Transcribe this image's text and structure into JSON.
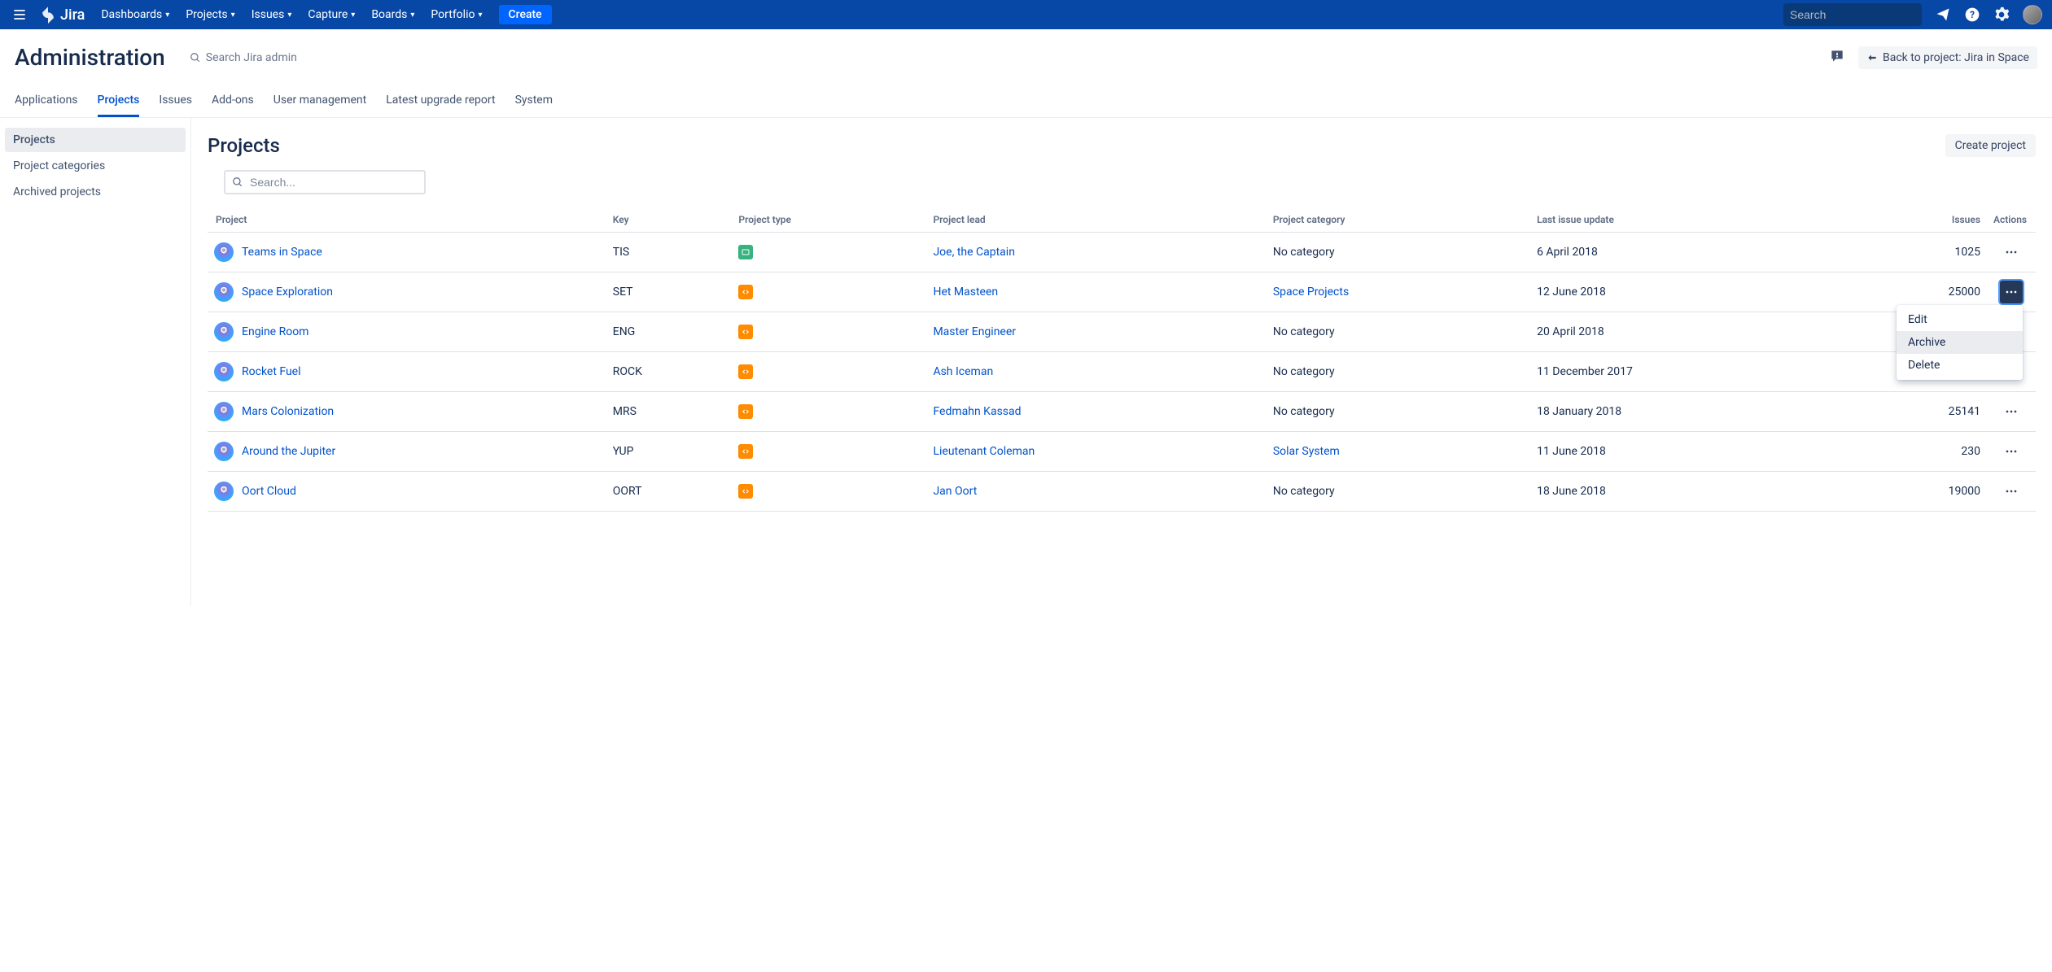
{
  "topnav": {
    "logo_text": "Jira",
    "items": [
      "Dashboards",
      "Projects",
      "Issues",
      "Capture",
      "Boards",
      "Portfolio"
    ],
    "create_label": "Create",
    "search_placeholder": "Search"
  },
  "admin": {
    "title": "Administration",
    "search_label": "Search Jira admin",
    "back_label": "Back to project: Jira in Space",
    "tabs": [
      "Applications",
      "Projects",
      "Issues",
      "Add-ons",
      "User management",
      "Latest upgrade report",
      "System"
    ],
    "active_tab_index": 1
  },
  "sidebar": {
    "items": [
      "Projects",
      "Project categories",
      "Archived projects"
    ],
    "active_index": 0
  },
  "main": {
    "title": "Projects",
    "create_project_label": "Create project",
    "filter_placeholder": "Search..."
  },
  "table": {
    "columns": [
      "Project",
      "Key",
      "Project type",
      "Project lead",
      "Project category",
      "Last issue update",
      "Issues",
      "Actions"
    ],
    "rows": [
      {
        "name": "Teams in Space",
        "key": "TIS",
        "type": "business",
        "lead": "Joe, the Captain",
        "category": "No category",
        "category_link": false,
        "updated": "6 April 2018",
        "issues": "1025"
      },
      {
        "name": "Space Exploration",
        "key": "SET",
        "type": "software",
        "lead": "Het Masteen",
        "category": "Space Projects",
        "category_link": true,
        "updated": "12 June 2018",
        "issues": "25000"
      },
      {
        "name": "Engine Room",
        "key": "ENG",
        "type": "software",
        "lead": "Master Engineer",
        "category": "No category",
        "category_link": false,
        "updated": "20 April 2018",
        "issues": ""
      },
      {
        "name": "Rocket Fuel",
        "key": "ROCK",
        "type": "software",
        "lead": "Ash Iceman",
        "category": "No category",
        "category_link": false,
        "updated": "11 December 2017",
        "issues": ""
      },
      {
        "name": "Mars Colonization",
        "key": "MRS",
        "type": "software",
        "lead": "Fedmahn Kassad",
        "category": "No category",
        "category_link": false,
        "updated": "18 January 2018",
        "issues": "25141"
      },
      {
        "name": "Around the Jupiter",
        "key": "YUP",
        "type": "software",
        "lead": "Lieutenant Coleman",
        "category": "Solar System",
        "category_link": true,
        "updated": "11 June 2018",
        "issues": "230"
      },
      {
        "name": "Oort Cloud",
        "key": "OORT",
        "type": "software",
        "lead": "Jan Oort",
        "category": "No category",
        "category_link": false,
        "updated": "18 June 2018",
        "issues": "19000"
      }
    ]
  },
  "dropdown": {
    "open_row_index": 1,
    "hover_index": 1,
    "items": [
      "Edit",
      "Archive",
      "Delete"
    ]
  }
}
